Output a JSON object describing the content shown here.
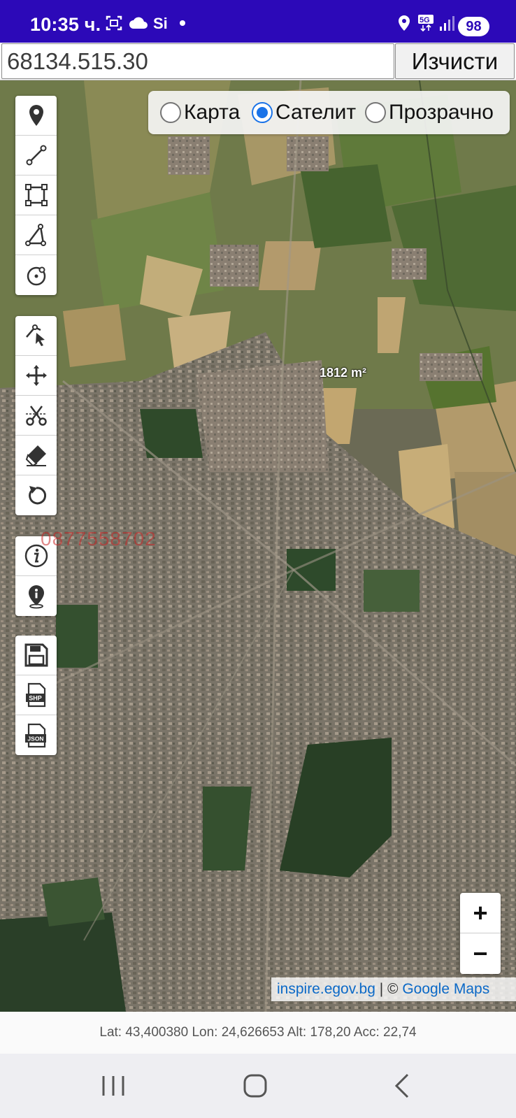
{
  "status_bar": {
    "time": "10:35 ч.",
    "battery": "98",
    "network": "5G"
  },
  "search": {
    "value": "68134.515.30",
    "clear_label": "Изчисти"
  },
  "layers": {
    "options": [
      {
        "label": "Карта",
        "checked": false
      },
      {
        "label": "Сателит",
        "checked": true
      },
      {
        "label": "Прозрачно",
        "checked": false
      }
    ]
  },
  "toolbar": {
    "draw_group": [
      "marker-icon",
      "line-icon",
      "polygon-icon",
      "angle-icon",
      "circle-icon"
    ],
    "edit_group": [
      "select-icon",
      "move-icon",
      "cut-icon",
      "eraser-icon",
      "undo-icon"
    ],
    "info_group": [
      "info-icon",
      "location-info-icon"
    ],
    "export_group": [
      "save-icon",
      "shp-export-icon",
      "json-export-icon"
    ]
  },
  "map": {
    "watermark": "0877558702",
    "area_label": "1812 m²",
    "selected_layer": "Сателит"
  },
  "zoom": {
    "in": "+",
    "out": "−"
  },
  "attribution": {
    "source": "inspire.egov.bg",
    "separator": " | © ",
    "provider": "Google Maps"
  },
  "coords": {
    "text": "Lat: 43,400380 Lon: 24,626653 Alt: 178,20 Acc: 22,74"
  },
  "colors": {
    "status_bar": "#2c09b8",
    "accent": "#1a73e8",
    "link": "#0b69c7"
  }
}
